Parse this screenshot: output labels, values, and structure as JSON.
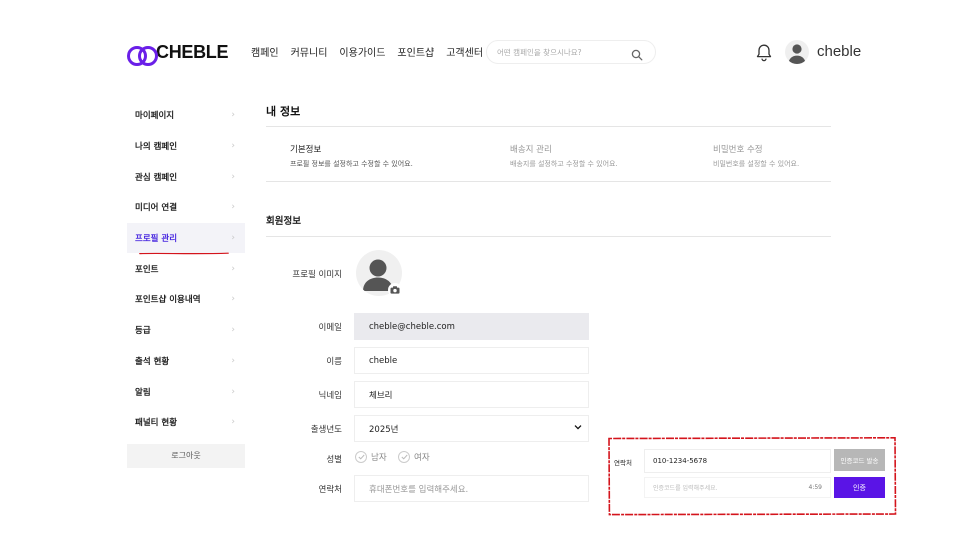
{
  "brand": {
    "name": "CHEBLE",
    "accent": "#6a1fe8"
  },
  "nav": [
    "캠페인",
    "커뮤니티",
    "이용가이드",
    "포인트샵",
    "고객센터"
  ],
  "search": {
    "placeholder": "어떤 캠페인을 찾으시나요?",
    "icon": "search-icon"
  },
  "user": {
    "name": "cheble"
  },
  "sidebar": {
    "items": [
      {
        "label": "마이페이지"
      },
      {
        "label": "나의 캠페인"
      },
      {
        "label": "관심 캠페인"
      },
      {
        "label": "미디어 연결"
      },
      {
        "label": "프로필 관리"
      },
      {
        "label": "포인트"
      },
      {
        "label": "포인트샵 이용내역"
      },
      {
        "label": "등급"
      },
      {
        "label": "출석 현황"
      },
      {
        "label": "알림"
      },
      {
        "label": "패널티 현황"
      }
    ],
    "active_index": 4,
    "logout": "로그아웃"
  },
  "page": {
    "title": "내 정보"
  },
  "tabs": [
    {
      "title": "기본정보",
      "desc": "프로필 정보를 설정하고 수정할 수 있어요."
    },
    {
      "title": "배송지 관리",
      "desc": "배송지를 설정하고 수정할 수 있어요."
    },
    {
      "title": "비밀번호 수정",
      "desc": "비밀번호를 설정할 수 있어요."
    }
  ],
  "form": {
    "section_title": "회원정보",
    "profile_image_label": "프로필 이미지",
    "email": {
      "label": "이메일",
      "value": "cheble@cheble.com"
    },
    "name": {
      "label": "이름",
      "value": "cheble"
    },
    "nickname": {
      "label": "닉네임",
      "value": "체브리"
    },
    "birth_year": {
      "label": "출생년도",
      "value": "2025년"
    },
    "gender": {
      "label": "성별",
      "options": [
        "남자",
        "여자"
      ]
    },
    "phone": {
      "label": "연락처",
      "placeholder": "휴대폰번호를 입력해주세요."
    }
  },
  "verify": {
    "label": "연락처",
    "phone_value": "010-1234-5678",
    "send_button": "인증코드 발송",
    "code_placeholder": "인증코드를 입력해주세요.",
    "timer": "4:59",
    "verify_button": "인증"
  }
}
